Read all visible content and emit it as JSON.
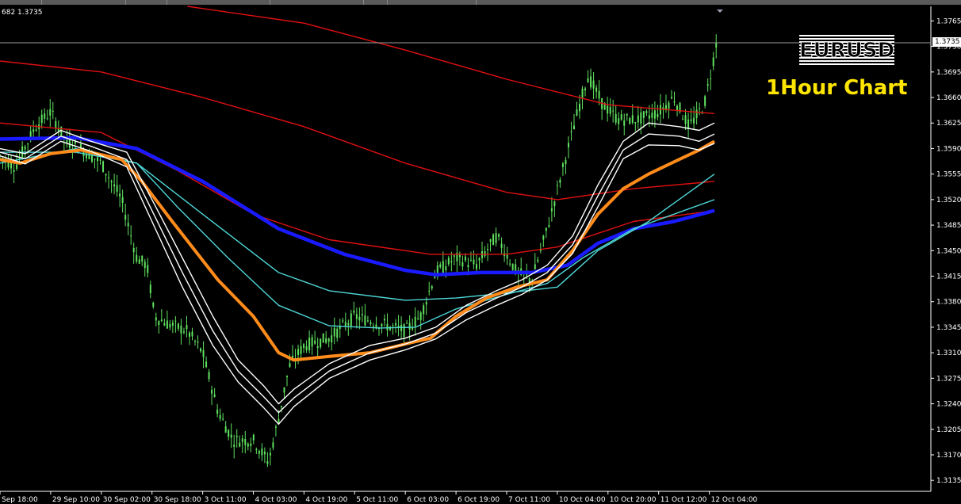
{
  "header": {
    "info": "682 1.3735"
  },
  "overlay": {
    "symbol": "EURUSD",
    "subtitle": "1Hour Chart"
  },
  "current_price": "1.3735",
  "colors": {
    "background": "#000000",
    "candles": "#5fe35f",
    "white_ma": "#ffffff",
    "orange_ma": "#ff8c1a",
    "blue_ma": "#1a1aff",
    "cyan_ma": "#4fd6d6",
    "red_ma": "#e01010",
    "subtitle": "#ffe600"
  },
  "chart_data": {
    "type": "line",
    "title": "",
    "ylim": [
      1.312,
      1.3785
    ],
    "y_ticks": [
      "1.3765",
      "1.3730",
      "1.3695",
      "1.3660",
      "1.3625",
      "1.3590",
      "1.3555",
      "1.3520",
      "1.3485",
      "1.3450",
      "1.3415",
      "1.3380",
      "1.3345",
      "1.3310",
      "1.3275",
      "1.3240",
      "1.3205",
      "1.3170",
      "1.3135"
    ],
    "x_ticks": [
      "Sep 18:00",
      "29 Sep 10:00",
      "30 Sep 02:00",
      "30 Sep 18:00",
      "3 Oct 11:00",
      "4 Oct 03:00",
      "4 Oct 19:00",
      "5 Oct 11:00",
      "6 Oct 03:00",
      "6 Oct 19:00",
      "7 Oct 11:00",
      "10 Oct 04:00",
      "10 Oct 20:00",
      "11 Oct 12:00",
      "12 Oct 04:00"
    ],
    "x_range": [
      0,
      14.5
    ],
    "price_points": [
      [
        0,
        1.358
      ],
      [
        0.3,
        1.3565
      ],
      [
        0.7,
        1.362
      ],
      [
        1.0,
        1.364
      ],
      [
        1.3,
        1.36
      ],
      [
        1.6,
        1.359
      ],
      [
        2.0,
        1.357
      ],
      [
        2.4,
        1.352
      ],
      [
        2.7,
        1.344
      ],
      [
        2.9,
        1.343
      ],
      [
        3.05,
        1.336
      ],
      [
        3.3,
        1.335
      ],
      [
        3.7,
        1.334
      ],
      [
        4.0,
        1.331
      ],
      [
        4.3,
        1.323
      ],
      [
        4.6,
        1.319
      ],
      [
        5.0,
        1.319
      ],
      [
        5.3,
        1.316
      ],
      [
        5.5,
        1.322
      ],
      [
        5.7,
        1.329
      ],
      [
        6.0,
        1.332
      ],
      [
        6.5,
        1.333
      ],
      [
        7.0,
        1.336
      ],
      [
        7.5,
        1.335
      ],
      [
        8.0,
        1.334
      ],
      [
        8.3,
        1.336
      ],
      [
        8.6,
        1.342
      ],
      [
        9.0,
        1.344
      ],
      [
        9.4,
        1.343
      ],
      [
        9.8,
        1.347
      ],
      [
        10.2,
        1.342
      ],
      [
        10.5,
        1.341
      ],
      [
        10.8,
        1.348
      ],
      [
        11.1,
        1.356
      ],
      [
        11.4,
        1.364
      ],
      [
        11.6,
        1.369
      ],
      [
        11.9,
        1.365
      ],
      [
        12.2,
        1.363
      ],
      [
        12.6,
        1.363
      ],
      [
        13.0,
        1.364
      ],
      [
        13.3,
        1.366
      ],
      [
        13.6,
        1.362
      ],
      [
        13.9,
        1.365
      ],
      [
        14.05,
        1.37
      ],
      [
        14.15,
        1.374
      ]
    ],
    "series": [
      {
        "color": "#e01010",
        "points": [
          [
            3.7,
            1.3785
          ],
          [
            6.0,
            1.3762
          ],
          [
            8.0,
            1.3725
          ],
          [
            10.0,
            1.3685
          ],
          [
            12.0,
            1.365
          ],
          [
            14.1,
            1.3638
          ]
        ]
      },
      {
        "color": "#e01010",
        "points": [
          [
            0,
            1.3625
          ],
          [
            2.0,
            1.3612
          ],
          [
            3.5,
            1.356
          ],
          [
            5.0,
            1.35
          ],
          [
            6.5,
            1.3465
          ],
          [
            8.5,
            1.3445
          ],
          [
            10.0,
            1.3445
          ],
          [
            11.0,
            1.3455
          ],
          [
            12.5,
            1.349
          ],
          [
            14.1,
            1.3505
          ]
        ]
      },
      {
        "color": "#e01010",
        "points": [
          [
            0,
            1.371
          ],
          [
            2.0,
            1.3695
          ],
          [
            4.0,
            1.366
          ],
          [
            6.0,
            1.362
          ],
          [
            8.0,
            1.357
          ],
          [
            10.0,
            1.353
          ],
          [
            11.0,
            1.352
          ],
          [
            12.5,
            1.3535
          ],
          [
            14.1,
            1.3545
          ]
        ]
      },
      {
        "color": "#1a1aff",
        "points": [
          [
            0,
            1.3603
          ],
          [
            1.5,
            1.3605
          ],
          [
            2.7,
            1.359
          ],
          [
            4.0,
            1.3545
          ],
          [
            5.5,
            1.348
          ],
          [
            6.8,
            1.3445
          ],
          [
            8.0,
            1.3423
          ],
          [
            8.6,
            1.3417
          ],
          [
            9.5,
            1.342
          ],
          [
            10.5,
            1.342
          ],
          [
            11.2,
            1.343
          ],
          [
            11.8,
            1.346
          ],
          [
            12.5,
            1.348
          ],
          [
            13.3,
            1.349
          ],
          [
            14.1,
            1.3505
          ]
        ]
      },
      {
        "color": "#4fd6d6",
        "points": [
          [
            0,
            1.3585
          ],
          [
            1.5,
            1.3585
          ],
          [
            2.7,
            1.357
          ],
          [
            4.0,
            1.35
          ],
          [
            5.5,
            1.342
          ],
          [
            6.5,
            1.3395
          ],
          [
            8.0,
            1.3382
          ],
          [
            9.0,
            1.3385
          ],
          [
            10.0,
            1.3392
          ],
          [
            11.0,
            1.34
          ],
          [
            11.8,
            1.345
          ],
          [
            12.8,
            1.349
          ],
          [
            14.1,
            1.3555
          ]
        ]
      },
      {
        "color": "#4fd6d6",
        "points": [
          [
            0,
            1.357
          ],
          [
            1.5,
            1.359
          ],
          [
            2.7,
            1.357
          ],
          [
            3.5,
            1.351
          ],
          [
            4.5,
            1.344
          ],
          [
            5.5,
            1.3375
          ],
          [
            6.5,
            1.3347
          ],
          [
            7.5,
            1.3344
          ],
          [
            8.2,
            1.3345
          ],
          [
            9.0,
            1.337
          ],
          [
            10.0,
            1.339
          ],
          [
            10.8,
            1.3405
          ],
          [
            11.5,
            1.344
          ],
          [
            12.5,
            1.348
          ],
          [
            14.1,
            1.352
          ]
        ]
      },
      {
        "color": "#ff8c1a",
        "points": [
          [
            0,
            1.3575
          ],
          [
            0.4,
            1.357
          ],
          [
            1.0,
            1.3583
          ],
          [
            1.6,
            1.3588
          ],
          [
            2.4,
            1.3575
          ],
          [
            2.8,
            1.3545
          ],
          [
            3.4,
            1.349
          ],
          [
            4.3,
            1.341
          ],
          [
            5.0,
            1.336
          ],
          [
            5.5,
            1.331
          ],
          [
            5.8,
            1.33
          ],
          [
            6.5,
            1.3305
          ],
          [
            7.3,
            1.331
          ],
          [
            8.0,
            1.3322
          ],
          [
            8.5,
            1.333
          ],
          [
            9.0,
            1.336
          ],
          [
            9.6,
            1.3385
          ],
          [
            10.2,
            1.34
          ],
          [
            10.8,
            1.341
          ],
          [
            11.3,
            1.345
          ],
          [
            11.8,
            1.35
          ],
          [
            12.3,
            1.3535
          ],
          [
            12.8,
            1.3555
          ],
          [
            13.4,
            1.3575
          ],
          [
            13.8,
            1.3588
          ],
          [
            14.1,
            1.36
          ]
        ]
      },
      {
        "color": "#ffffff",
        "points": [
          [
            0,
            1.359
          ],
          [
            0.5,
            1.3583
          ],
          [
            1.2,
            1.3615
          ],
          [
            1.8,
            1.36
          ],
          [
            2.5,
            1.3585
          ],
          [
            3.0,
            1.352
          ],
          [
            3.6,
            1.344
          ],
          [
            4.2,
            1.336
          ],
          [
            4.7,
            1.33
          ],
          [
            5.2,
            1.3265
          ],
          [
            5.5,
            1.324
          ],
          [
            5.8,
            1.326
          ],
          [
            6.5,
            1.3295
          ],
          [
            7.3,
            1.332
          ],
          [
            8.0,
            1.333
          ],
          [
            8.6,
            1.3345
          ],
          [
            9.2,
            1.3375
          ],
          [
            9.8,
            1.3395
          ],
          [
            10.3,
            1.341
          ],
          [
            10.8,
            1.343
          ],
          [
            11.3,
            1.347
          ],
          [
            11.8,
            1.354
          ],
          [
            12.3,
            1.36
          ],
          [
            12.8,
            1.3625
          ],
          [
            13.4,
            1.362
          ],
          [
            13.8,
            1.3615
          ],
          [
            14.1,
            1.3625
          ]
        ]
      },
      {
        "color": "#ffffff",
        "points": [
          [
            0,
            1.3585
          ],
          [
            0.5,
            1.3576
          ],
          [
            1.2,
            1.3607
          ],
          [
            1.8,
            1.3593
          ],
          [
            2.5,
            1.3575
          ],
          [
            3.0,
            1.3505
          ],
          [
            3.6,
            1.342
          ],
          [
            4.2,
            1.334
          ],
          [
            4.7,
            1.3285
          ],
          [
            5.2,
            1.325
          ],
          [
            5.5,
            1.3228
          ],
          [
            5.8,
            1.3248
          ],
          [
            6.5,
            1.3285
          ],
          [
            7.3,
            1.331
          ],
          [
            8.0,
            1.3322
          ],
          [
            8.6,
            1.3337
          ],
          [
            9.2,
            1.3365
          ],
          [
            9.8,
            1.3385
          ],
          [
            10.3,
            1.34
          ],
          [
            10.8,
            1.342
          ],
          [
            11.3,
            1.3458
          ],
          [
            11.8,
            1.3525
          ],
          [
            12.3,
            1.3588
          ],
          [
            12.8,
            1.361
          ],
          [
            13.4,
            1.3607
          ],
          [
            13.8,
            1.36
          ],
          [
            14.1,
            1.361
          ]
        ]
      },
      {
        "color": "#ffffff",
        "points": [
          [
            0,
            1.358
          ],
          [
            0.5,
            1.3569
          ],
          [
            1.2,
            1.36
          ],
          [
            1.8,
            1.3586
          ],
          [
            2.5,
            1.3565
          ],
          [
            3.0,
            1.349
          ],
          [
            3.6,
            1.34
          ],
          [
            4.2,
            1.332
          ],
          [
            4.7,
            1.327
          ],
          [
            5.2,
            1.3235
          ],
          [
            5.5,
            1.3212
          ],
          [
            5.8,
            1.3236
          ],
          [
            6.5,
            1.3275
          ],
          [
            7.3,
            1.33
          ],
          [
            8.0,
            1.3314
          ],
          [
            8.6,
            1.3329
          ],
          [
            9.2,
            1.3355
          ],
          [
            9.8,
            1.3375
          ],
          [
            10.3,
            1.339
          ],
          [
            10.8,
            1.341
          ],
          [
            11.3,
            1.3446
          ],
          [
            11.8,
            1.351
          ],
          [
            12.3,
            1.3576
          ],
          [
            12.8,
            1.3595
          ],
          [
            13.4,
            1.3594
          ],
          [
            13.8,
            1.3588
          ],
          [
            14.1,
            1.3597
          ]
        ]
      }
    ]
  }
}
